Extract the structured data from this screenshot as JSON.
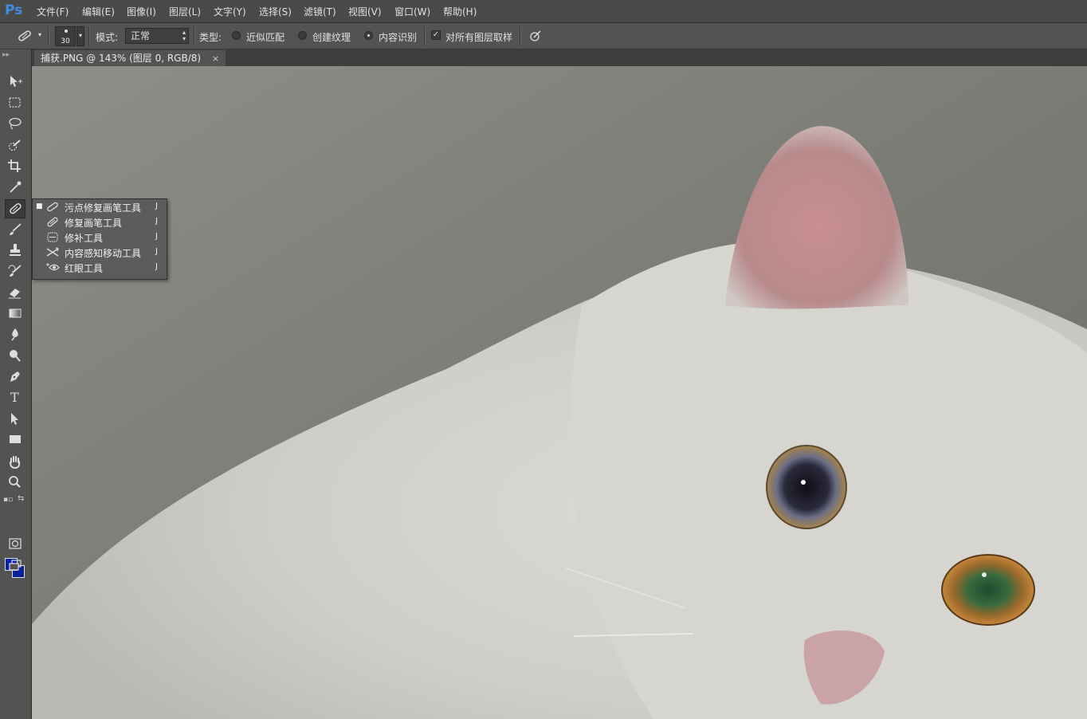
{
  "app": {
    "logo": "Ps"
  },
  "menu": [
    {
      "label": "文件(F)"
    },
    {
      "label": "编辑(E)"
    },
    {
      "label": "图像(I)"
    },
    {
      "label": "图层(L)"
    },
    {
      "label": "文字(Y)"
    },
    {
      "label": "选择(S)"
    },
    {
      "label": "滤镜(T)"
    },
    {
      "label": "视图(V)"
    },
    {
      "label": "窗口(W)"
    },
    {
      "label": "帮助(H)"
    }
  ],
  "options": {
    "brush_size": "30",
    "mode_label": "模式:",
    "mode_value": "正常",
    "type_label": "类型:",
    "type_options": [
      {
        "label": "近似匹配",
        "selected": false
      },
      {
        "label": "创建纹理",
        "selected": false
      },
      {
        "label": "内容识别",
        "selected": true
      }
    ],
    "sample_all_layers": {
      "label": "对所有图层取样",
      "checked": true
    }
  },
  "document": {
    "tab_title": "捕获.PNG @ 143% (图层 0, RGB/8)",
    "close": "×"
  },
  "toolbar": {
    "grip": "▸▸",
    "tools": [
      {
        "icon": "move-tool-icon"
      },
      {
        "icon": "marquee-tool-icon"
      },
      {
        "icon": "lasso-tool-icon"
      },
      {
        "icon": "quick-selection-tool-icon"
      },
      {
        "icon": "crop-tool-icon"
      },
      {
        "icon": "eyedropper-tool-icon"
      },
      {
        "icon": "spot-healing-brush-tool-icon",
        "active": true
      },
      {
        "icon": "brush-tool-icon"
      },
      {
        "icon": "clone-stamp-tool-icon"
      },
      {
        "icon": "history-brush-tool-icon"
      },
      {
        "icon": "eraser-tool-icon"
      },
      {
        "icon": "gradient-tool-icon"
      },
      {
        "icon": "blur-tool-icon"
      },
      {
        "icon": "dodge-tool-icon"
      },
      {
        "icon": "pen-tool-icon"
      },
      {
        "icon": "type-tool-icon"
      },
      {
        "icon": "path-selection-tool-icon"
      },
      {
        "icon": "rectangle-tool-icon"
      },
      {
        "icon": "hand-tool-icon"
      },
      {
        "icon": "zoom-tool-icon"
      }
    ],
    "foreground_color": "#0a1fa8",
    "background_color": "#0a1f9a"
  },
  "flyout": [
    {
      "label": "污点修复画笔工具",
      "shortcut": "J",
      "selected": true,
      "icon": "spot-healing-brush-icon"
    },
    {
      "label": "修复画笔工具",
      "shortcut": "J",
      "selected": false,
      "icon": "healing-brush-icon"
    },
    {
      "label": "修补工具",
      "shortcut": "J",
      "selected": false,
      "icon": "patch-tool-icon"
    },
    {
      "label": "内容感知移动工具",
      "shortcut": "J",
      "selected": false,
      "icon": "content-aware-move-icon"
    },
    {
      "label": "红眼工具",
      "shortcut": "J",
      "selected": false,
      "icon": "red-eye-tool-icon"
    }
  ]
}
